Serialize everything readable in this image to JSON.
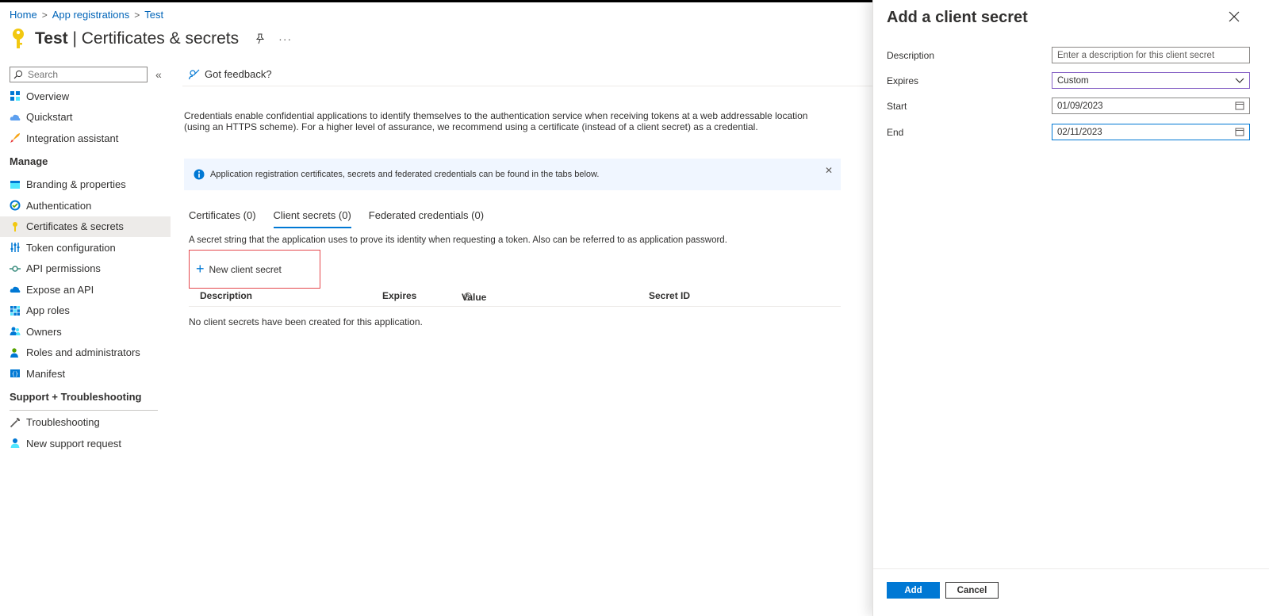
{
  "breadcrumb": [
    "Home",
    "App registrations",
    "Test"
  ],
  "header": {
    "app_name": "Test",
    "section": "Certificates & secrets"
  },
  "sidebar": {
    "search_placeholder": "Search",
    "items_top": [
      {
        "label": "Overview",
        "icon": "overview-grid-icon"
      },
      {
        "label": "Quickstart",
        "icon": "cloud-quickstart-icon"
      },
      {
        "label": "Integration assistant",
        "icon": "rocket-icon"
      }
    ],
    "manage_title": "Manage",
    "items_manage": [
      {
        "label": "Branding & properties",
        "icon": "branding-card-icon"
      },
      {
        "label": "Authentication",
        "icon": "authentication-icon"
      },
      {
        "label": "Certificates & secrets",
        "icon": "key-icon",
        "selected": true
      },
      {
        "label": "Token configuration",
        "icon": "sliders-icon"
      },
      {
        "label": "API permissions",
        "icon": "api-permissions-icon"
      },
      {
        "label": "Expose an API",
        "icon": "cloud-api-icon"
      },
      {
        "label": "App roles",
        "icon": "app-roles-grid-icon"
      },
      {
        "label": "Owners",
        "icon": "owners-people-icon"
      },
      {
        "label": "Roles and administrators",
        "icon": "roles-admin-icon"
      },
      {
        "label": "Manifest",
        "icon": "manifest-icon"
      }
    ],
    "support_title": "Support + Troubleshooting",
    "items_support": [
      {
        "label": "Troubleshooting",
        "icon": "wrench-icon"
      },
      {
        "label": "New support request",
        "icon": "support-person-icon"
      }
    ]
  },
  "main": {
    "feedback": "Got feedback?",
    "description": "Credentials enable confidential applications to identify themselves to the authentication service when receiving tokens at a web addressable location (using an HTTPS scheme). For a higher level of assurance, we recommend using a certificate (instead of a client secret) as a credential.",
    "info_message": "Application registration certificates, secrets and federated credentials can be found in the tabs below.",
    "tabs": [
      "Certificates (0)",
      "Client secrets (0)",
      "Federated credentials (0)"
    ],
    "secret_description": "A secret string that the application uses to prove its identity when requesting a token. Also can be referred to as application password.",
    "new_secret_label": "New client secret",
    "table_headers": [
      "Description",
      "Expires",
      "Value",
      "Secret ID"
    ],
    "empty_message": "No client secrets have been created for this application."
  },
  "panel": {
    "title": "Add a client secret",
    "labels": {
      "description": "Description",
      "expires": "Expires",
      "start": "Start",
      "end": "End"
    },
    "description_placeholder": "Enter a description for this client secret",
    "expires_value": "Custom",
    "start_value": "01/09/2023",
    "end_value": "02/11/2023",
    "add_label": "Add",
    "cancel_label": "Cancel"
  },
  "colors": {
    "accent": "#0078d4",
    "link": "#0064b8",
    "highlight_border": "#e5484d",
    "info_bg": "#f0f6ff"
  }
}
